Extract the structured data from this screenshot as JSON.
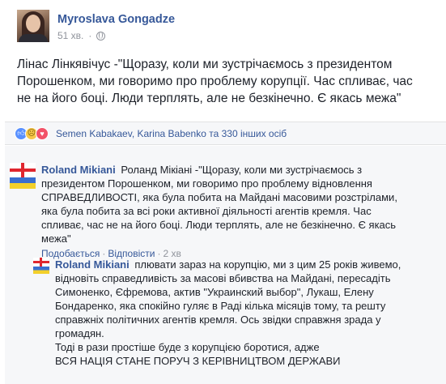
{
  "post": {
    "author": "Myroslava Gongadze",
    "time": "51 хв.",
    "text": "Лінас Лінкявічус -\"Щоразу, коли ми зустрічаємось з президентом Порошенком, ми говоримо про проблему корупції. Час спливає, час не на його боці. Люди терплять, але не безкінечно. Є якась межа\""
  },
  "reactions": {
    "names": "Semen Kabakaev, Karina Babenko",
    "others": " та 330 інших осіб"
  },
  "comments": [
    {
      "author": "Roland Mikiani",
      "text": "Роланд Мікіані -\"Щоразу, коли ми зустрічаємось з президентом Порошенком, ми говоримо про проблему відновлення СПРАВЕДЛИВОСТІ, яка була побита на Майдані масовими розстрілами, яка була побита за всі роки активної діяльності агентів кремля. Час спливає, час не на його боці. Люди терплять, але не безкінечно. Є якась межа\"",
      "like_label": "Подобається",
      "reply_label": "Відповісти",
      "time": "2 хв"
    },
    {
      "author": "Roland Mikiani",
      "text": "плювати зараз на корупцію, ми з цим 25 років живемо, відновіть справедливість за масові вбивства на Майдані, пересадіть Симоненко, Єфремова, актив \"Украинский выбор\", Лукаш, Елену Бондаренко, яка спокійно гуляє в Раді кількa місяців тому, та решту справжніх політичних агентів кремля. Ось звідки справжня зрада у громадян.",
      "text2": "Тоді в рази простіше буде з корупцією боротися, адже",
      "text3": "ВСЯ НАЦІЯ СТАНЕ ПОРУЧ З КЕРІВНИЦТВОМ ДЕРЖАВИ"
    }
  ]
}
